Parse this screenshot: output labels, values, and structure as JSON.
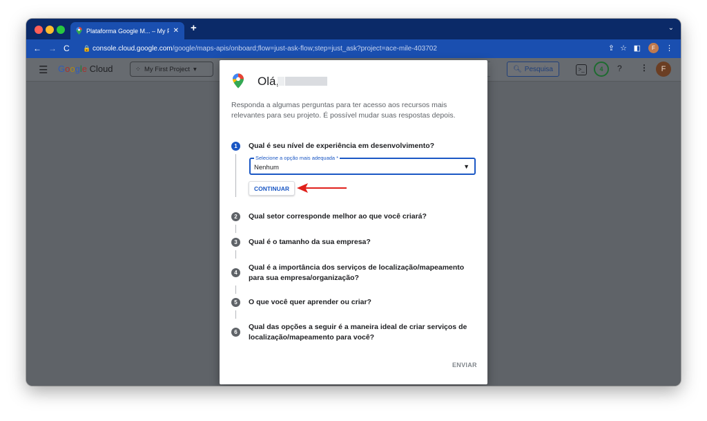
{
  "browser": {
    "tab_title": "Plataforma Google M... – My F",
    "tab_close": "✕",
    "new_tab": "+",
    "tab_menu": "⌄",
    "url_host": "console.cloud.google.com",
    "url_path": "/google/maps-apis/onboard;flow=just-ask-flow;step=just_ask?project=ace-mile-403702",
    "profile_initial": "F"
  },
  "header": {
    "logo_google": [
      "G",
      "o",
      "o",
      "g",
      "l",
      "e"
    ],
    "logo_cloud": " Cloud",
    "project_name": "My First Project",
    "search_label": "Pesquisa",
    "notifications_count": "4",
    "avatar_initial": "F"
  },
  "dialog": {
    "greeting": "Olá,",
    "intro": "Responda a algumas perguntas para ter acesso aos recursos mais relevantes para seu projeto. É possível mudar suas respostas depois.",
    "steps": [
      {
        "num": "1",
        "question": "Qual é seu nível de experiência em desenvolvimento?"
      },
      {
        "num": "2",
        "question": "Qual setor corresponde melhor ao que você criará?"
      },
      {
        "num": "3",
        "question": "Qual é o tamanho da sua empresa?"
      },
      {
        "num": "4",
        "question": "Qual é a importância dos serviços de localização/mapeamento para sua empresa/organização?"
      },
      {
        "num": "5",
        "question": "O que você quer aprender ou criar?"
      },
      {
        "num": "6",
        "question": "Qual das opções a seguir é a maneira ideal de criar serviços de localização/mapeamento para você?"
      }
    ],
    "select_label": "Selecione a opção mais adequada *",
    "select_value": "Nenhum",
    "continue_label": "CONTINUAR",
    "send_label": "ENVIAR"
  },
  "colors": {
    "accent": "#1a57c4",
    "arrow": "#e0201b",
    "tabstrip": "#0b2a68",
    "toolbar": "#1a4fb0"
  }
}
